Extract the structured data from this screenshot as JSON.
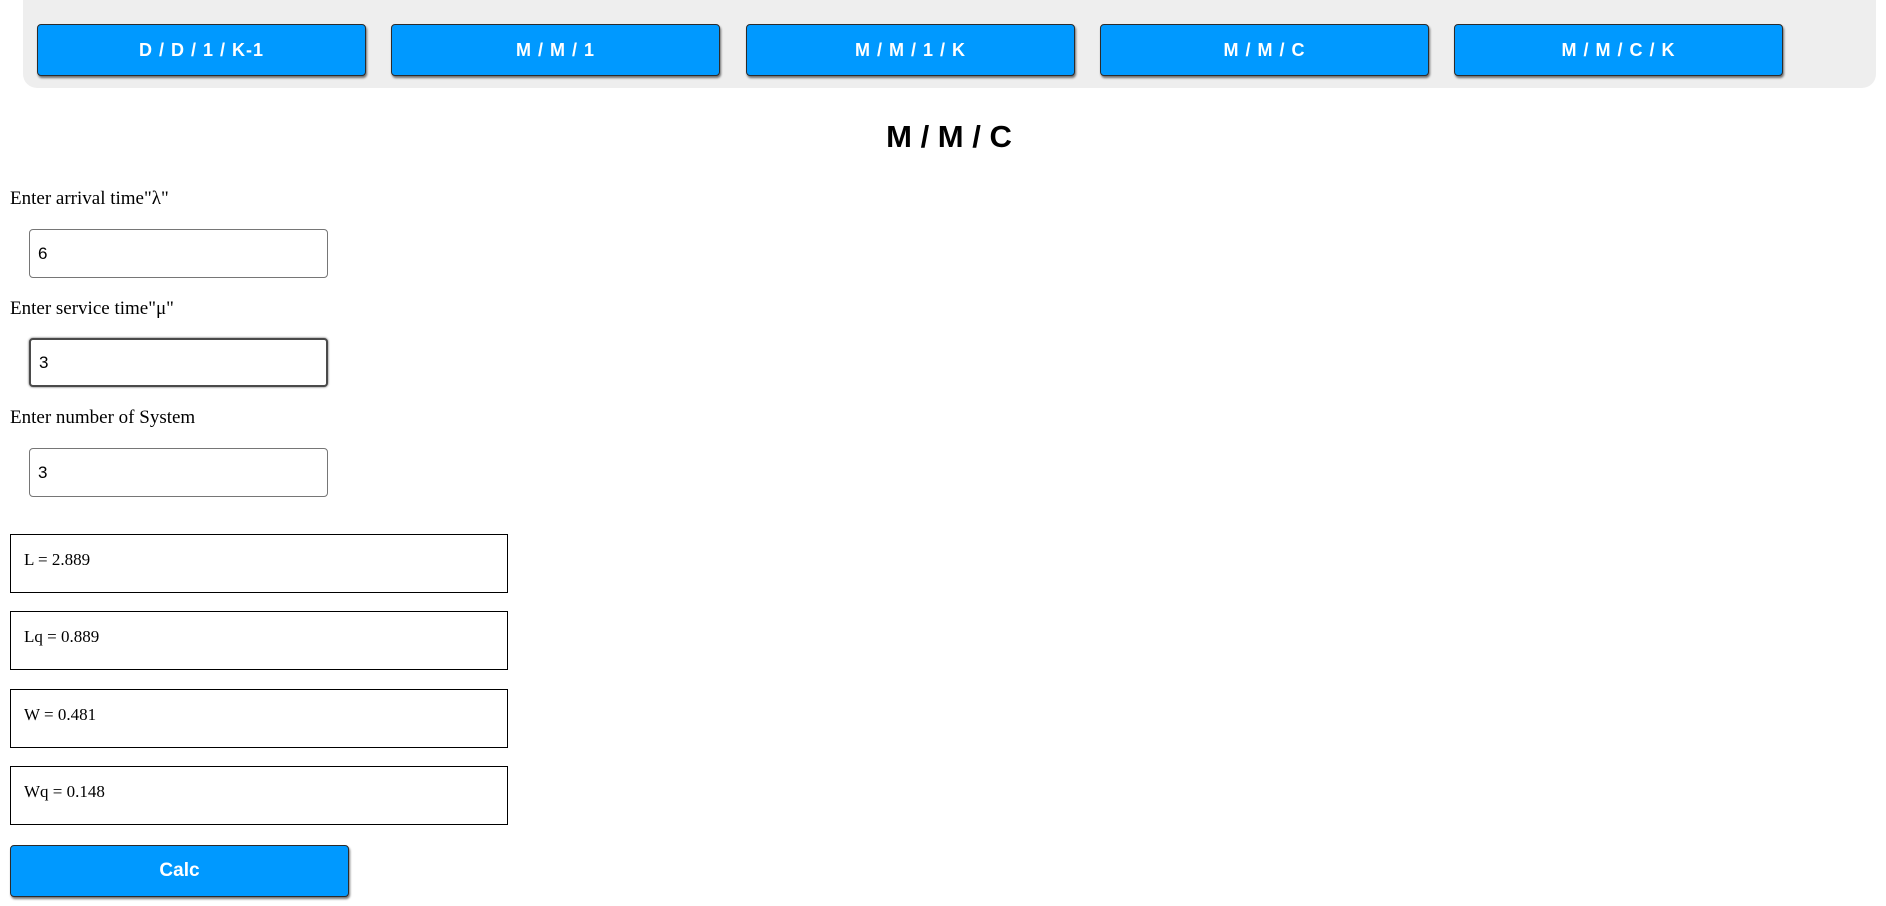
{
  "nav": {
    "buttons": [
      {
        "label": "D / D / 1 / K-1"
      },
      {
        "label": "M / M / 1"
      },
      {
        "label": "M / M / 1 / K"
      },
      {
        "label": "M / M / C"
      },
      {
        "label": "M / M / C / K"
      }
    ]
  },
  "page_title": "M / M / C",
  "form": {
    "arrival": {
      "label": "Enter arrival time\"λ\"",
      "value": "6"
    },
    "service": {
      "label": "Enter service time\"μ\"",
      "value": "3"
    },
    "servers": {
      "label": "Enter number of System",
      "value": "3"
    }
  },
  "results": {
    "L": "L = 2.889",
    "Lq": "Lq = 0.889",
    "W": "W = 0.481",
    "Wq": "Wq = 0.148"
  },
  "calc_button": "Calc",
  "colors": {
    "button_bg": "#0099ff",
    "nav_bg": "#eeeeee"
  }
}
